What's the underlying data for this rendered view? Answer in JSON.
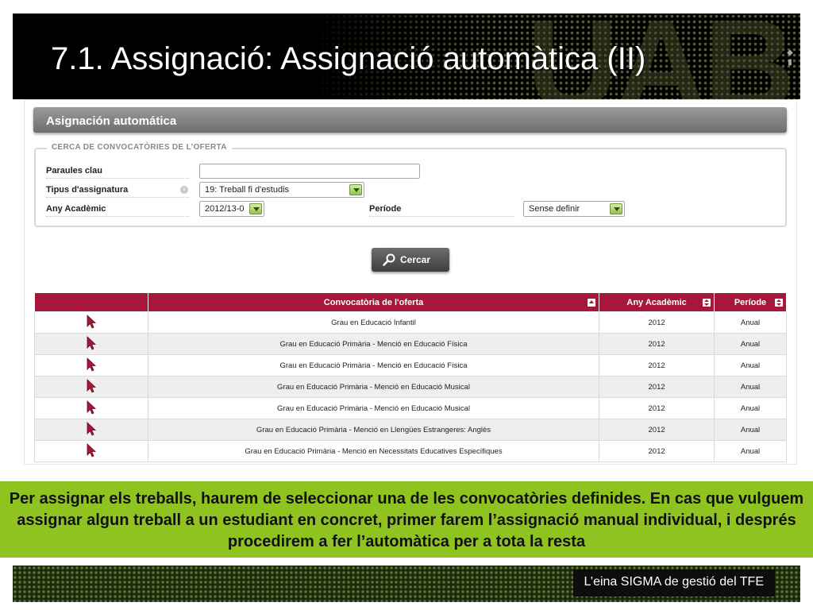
{
  "slide": {
    "title": "7.1. Assignació: Assignació automàtica (II)",
    "info_text": "Per assignar els treballs, haurem de seleccionar una de les convocatòries definides. En cas que vulguem assignar algun treball a un estudiant en concret, primer farem l’assignació manual individual, i després procedirem a fer l’automàtica per a tota la resta",
    "footer_tag": "L’eina SIGMA de gestió del TFE"
  },
  "app": {
    "header": "Asignación automática",
    "search": {
      "legend": "CERCA DE CONVOCATÒRIES DE L'OFERTA",
      "keywords_label": "Paraules clau",
      "keywords_value": "",
      "subject_type_label": "Tipus d'assignatura",
      "subject_type_value": "19: Treball fi d'estudis",
      "year_label": "Any Acadèmic",
      "year_value": "2012/13-0",
      "period_label": "Període",
      "period_value": "Sense definir",
      "search_button": "Cercar"
    },
    "table": {
      "headers": [
        "",
        "Convocatòria de l'oferta",
        "Any Acadèmic",
        "Període"
      ],
      "rows": [
        {
          "name": "Grau en Educació Infantil",
          "year": "2012",
          "period": "Anual"
        },
        {
          "name": "Grau en Educació Primària - Menció en Educació Física",
          "year": "2012",
          "period": "Anual"
        },
        {
          "name": "Grau en Educació Primària - Menció en Educació Física",
          "year": "2012",
          "period": "Anual"
        },
        {
          "name": "Grau en Educació Primària - Menció en Educació Musical",
          "year": "2012",
          "period": "Anual"
        },
        {
          "name": "Grau en Educació Primària - Menció en Educació Musical",
          "year": "2012",
          "period": "Anual"
        },
        {
          "name": "Grau en Educació Primària - Menció en Llengües Estrangeres: Anglès",
          "year": "2012",
          "period": "Anual"
        },
        {
          "name": "Grau en Educació Primària - Menció en Necessitats Educatives Específiques",
          "year": "2012",
          "period": "Anual"
        }
      ]
    }
  },
  "colors": {
    "table_header": "#a8163a",
    "info_band": "#8fc31f",
    "select_arrow": "#94c24f"
  },
  "icons": {
    "row_select": "cursor-arrow-icon",
    "search": "magnifier-icon",
    "clear": "clear-x-icon",
    "sort": "sort-icon"
  }
}
